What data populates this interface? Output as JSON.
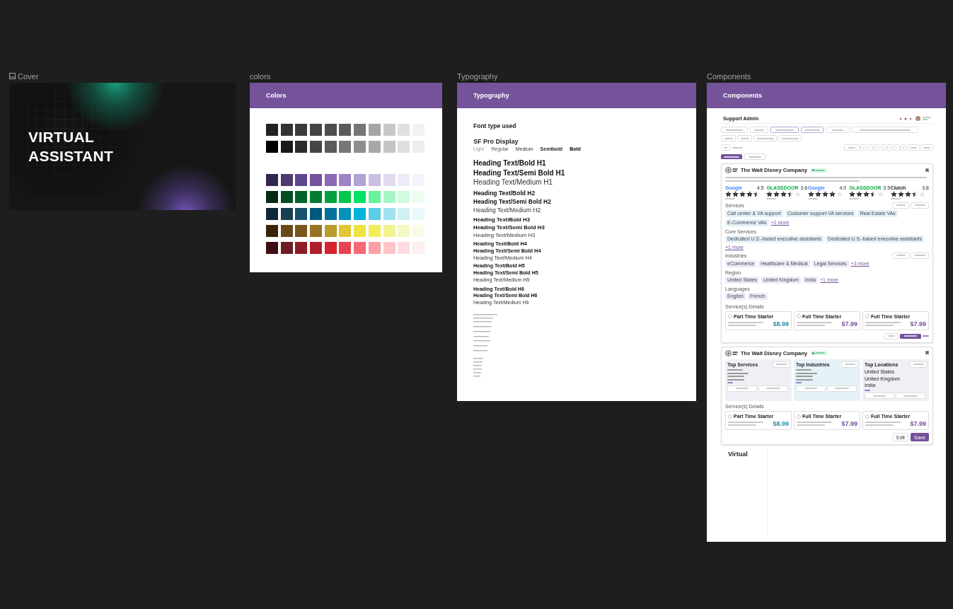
{
  "cover": {
    "label": "Cover",
    "title_lines": [
      "VIRTUAL",
      "ASSISTANT"
    ]
  },
  "colors": {
    "label": "colors",
    "header": "Colors",
    "groups": [
      {
        "rows": [
          [
            {
              "color": "#222222"
            },
            {
              "color": "#333333"
            },
            {
              "color": "#3a3a3a"
            },
            {
              "color": "#444444"
            },
            {
              "color": "#4d4d4d"
            },
            {
              "color": "#5c5c5c"
            },
            {
              "color": "#767676"
            },
            {
              "color": "#a6a6a6"
            },
            {
              "color": "#c8c8c8"
            },
            {
              "color": "#e0e0e0"
            },
            {
              "color": "#f2f2f2"
            }
          ],
          [
            {
              "color": "#000000"
            },
            {
              "color": "#1a1a1a"
            },
            {
              "color": "#2b2b2b"
            },
            {
              "color": "#454545"
            },
            {
              "color": "#5a5a5a"
            },
            {
              "color": "#767676"
            },
            {
              "color": "#8e8e8e"
            },
            {
              "color": "#a8a8a8"
            },
            {
              "color": "#c4c4c4"
            },
            {
              "color": "#dedede"
            },
            {
              "color": "#eeeeee"
            }
          ]
        ]
      },
      {
        "rows": [
          [
            {
              "color": "#33264d"
            },
            {
              "color": "#4e3a6e"
            },
            {
              "color": "#5f4590"
            },
            {
              "color": "#74519b"
            },
            {
              "color": "#8b68b3"
            },
            {
              "color": "#9d82c4"
            },
            {
              "color": "#b3a2d6"
            },
            {
              "color": "#cbbfe4"
            },
            {
              "color": "#e0d9ef"
            },
            {
              "color": "#eeeaf6"
            },
            {
              "color": "#f6f4fa"
            }
          ],
          [
            {
              "color": "#062b12"
            },
            {
              "color": "#014d22"
            },
            {
              "color": "#016428"
            },
            {
              "color": "#027c32"
            },
            {
              "color": "#02a03c"
            },
            {
              "color": "#03c64a"
            },
            {
              "color": "#05e266"
            },
            {
              "color": "#65f49b"
            },
            {
              "color": "#a4f7c4"
            },
            {
              "color": "#d1fbe1"
            },
            {
              "color": "#edfdf2"
            }
          ],
          [
            {
              "color": "#0e2838"
            },
            {
              "color": "#183e52"
            },
            {
              "color": "#17516b"
            },
            {
              "color": "#00587c"
            },
            {
              "color": "#03729a"
            },
            {
              "color": "#0592b8"
            },
            {
              "color": "#03b3d9"
            },
            {
              "color": "#5bcde6"
            },
            {
              "color": "#9fe2ef"
            },
            {
              "color": "#cff1f6"
            },
            {
              "color": "#eaf9fb"
            }
          ],
          [
            {
              "color": "#3b230a"
            },
            {
              "color": "#6b4a1a"
            },
            {
              "color": "#7a561c"
            },
            {
              "color": "#977322"
            },
            {
              "color": "#bb9b2c"
            },
            {
              "color": "#e0c733"
            },
            {
              "color": "#eee241"
            },
            {
              "color": "#f0ef5a"
            },
            {
              "color": "#f2f38f"
            },
            {
              "color": "#f4f8c3"
            },
            {
              "color": "#f9fbe6"
            }
          ],
          [
            {
              "color": "#3d0e13"
            },
            {
              "color": "#701c24"
            },
            {
              "color": "#8f1d26"
            },
            {
              "color": "#b11f2a"
            },
            {
              "color": "#d5242f"
            },
            {
              "color": "#e84350"
            },
            {
              "color": "#f46a77"
            },
            {
              "color": "#fca0a5"
            },
            {
              "color": "#fec5c8"
            },
            {
              "color": "#fedcdf"
            },
            {
              "color": "#feeeee"
            }
          ]
        ]
      }
    ]
  },
  "typography": {
    "label": "Typography",
    "header": "Typography",
    "section_title": "Font type used",
    "font_name": "SF Pro Display",
    "weights": [
      {
        "text": "Light",
        "kind": "light"
      },
      {
        "text": "Regular",
        "kind": "regular"
      },
      {
        "text": "Medium",
        "kind": "medium"
      },
      {
        "text": "Semibold",
        "kind": "semibold"
      },
      {
        "text": "Bold",
        "kind": "bold"
      }
    ],
    "heading_groups": [
      {
        "kind": "h1",
        "samples": [
          {
            "text": "Heading Text/Bold H1",
            "kind": "bold"
          },
          {
            "text": "Heading Text/Semi Bold H1",
            "kind": "semibold"
          },
          {
            "text": "Heading Text/Medium H1",
            "kind": "medium"
          }
        ]
      },
      {
        "kind": "h2",
        "samples": [
          {
            "text": "Heading Text/Bold H2",
            "kind": "bold"
          },
          {
            "text": "Heading Text/Semi Bold H2",
            "kind": "semibold"
          },
          {
            "text": "Heading Text/Medium H2",
            "kind": "medium"
          }
        ]
      },
      {
        "kind": "h3",
        "samples": [
          {
            "text": "Heading Text/Bold H3",
            "kind": "bold"
          },
          {
            "text": "Heading Text/Semi Bold H3",
            "kind": "semibold"
          },
          {
            "text": "Heading Text/Medium H3",
            "kind": "medium"
          }
        ]
      },
      {
        "kind": "h4",
        "samples": [
          {
            "text": "Heading Text/Bold H4",
            "kind": "bold"
          },
          {
            "text": "Heading Text/Semi Bold H4",
            "kind": "semibold"
          },
          {
            "text": "Heading Text/Medium H4",
            "kind": "medium"
          }
        ]
      },
      {
        "kind": "h5",
        "samples": [
          {
            "text": "Heading Text/Bold H5",
            "kind": "bold"
          },
          {
            "text": "Heading Text/Semi Bold H5",
            "kind": "semibold"
          },
          {
            "text": "Heading Text/Medium H5",
            "kind": "medium"
          }
        ]
      },
      {
        "kind": "h6",
        "samples": [
          {
            "text": "Heading Text/Bold H6",
            "kind": "bold"
          },
          {
            "text": "Heading Text/Semi Bold H6",
            "kind": "semibold"
          },
          {
            "text": "Heading Text/Medium H6",
            "kind": "medium"
          }
        ]
      }
    ]
  },
  "components": {
    "label": "Components",
    "header": "Components",
    "top_bar": {
      "title": "Support Admin"
    },
    "cards": [
      {
        "kind": "detail",
        "company": "The Walt Disney Company",
        "ratings": [
          {
            "source": "Google",
            "score": "4.5",
            "stars": 4.5
          },
          {
            "source": "GLASSDOOR",
            "score": "3.6",
            "stars": 3.5
          },
          {
            "source": "Google",
            "score": "4.0",
            "stars": 4
          },
          {
            "source": "GLASSDOOR",
            "score": "3.5",
            "stars": 3.5
          },
          {
            "source": "Clutch",
            "score": "3.8",
            "stars": 3.5
          }
        ],
        "sections": [
          {
            "title": "Services",
            "color": "#e4f1f6",
            "chips": [
              "Call center & VA support",
              "Customer support VA services",
              "Real Estate VAs",
              "E-Commerce VAs"
            ],
            "more": "+2 more"
          },
          {
            "title": "Core Services",
            "color": "#e4f1f6",
            "chips": [
              "Dedicated U.S.-based executive assistants",
              "Dedicated U.S.-based executive assistants"
            ],
            "more": "+1 more"
          },
          {
            "title": "Industries",
            "color": "#efeaf6",
            "chips": [
              "eCommerce",
              "Healthcare & Medical",
              "Legal Services"
            ],
            "more": "+3 more"
          },
          {
            "title": "Region",
            "color": "#efeaf6",
            "chips": [
              "United States",
              "United Kingdom",
              "India"
            ],
            "more": "+1 more"
          },
          {
            "title": "Languages",
            "color": "#efeaf6",
            "chips": [
              "English",
              "French"
            ]
          }
        ],
        "details_title": "Service(s) Details",
        "plans": [
          {
            "name": "Part Time Starter",
            "price": "$8.99",
            "color": "#2f8fa6",
            "selected": false
          },
          {
            "name": "Full Time Starter",
            "price": "$7.99",
            "color": "#74519b",
            "selected": false
          },
          {
            "name": "Full Time Starter",
            "price": "$7.99",
            "color": "#74519b",
            "selected": false
          }
        ]
      },
      {
        "kind": "summary",
        "company": "The Walt Disney Company",
        "panels": [
          {
            "title": "Top Services",
            "color": "#f1eff6"
          },
          {
            "title": "Top Industries",
            "color": "#e6f2f7"
          },
          {
            "title": "Top Locations",
            "color": "#f1eff6",
            "items": [
              "United States",
              "United Kingdom",
              "India"
            ]
          }
        ],
        "details_title": "Service(s) Details",
        "plans": [
          {
            "name": "Part Time Starter",
            "price": "$8.99",
            "color": "#2f8fa6",
            "selected": false
          },
          {
            "name": "Full Time Starter",
            "price": "$7.99",
            "color": "#74519b",
            "selected": false
          },
          {
            "name": "Full Time Starter",
            "price": "$7.99",
            "color": "#74519b",
            "selected": false
          }
        ],
        "buttons": [
          "Edit",
          "Save"
        ]
      }
    ],
    "footer_logo": "Virtual"
  }
}
